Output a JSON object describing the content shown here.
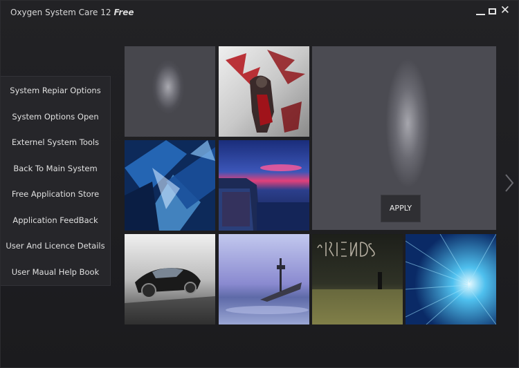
{
  "app": {
    "title": "Oxygen System Care 12",
    "edition": "Free"
  },
  "window_controls": {
    "minimize": "minimize-icon",
    "maximize": "maximize-icon",
    "close": "close-icon"
  },
  "sidebar": {
    "items": [
      {
        "label": "System Repiar Options"
      },
      {
        "label": "System Options Open"
      },
      {
        "label": "Externel System Tools"
      },
      {
        "label": "Back To Main System"
      },
      {
        "label": "Free Application Store"
      },
      {
        "label": "Application FeedBack"
      },
      {
        "label": "User And Licence Details"
      },
      {
        "label": "User Maual Help Book"
      }
    ]
  },
  "wallpapers": [
    {
      "name": "blurred-gray"
    },
    {
      "name": "red-warrior-art"
    },
    {
      "name": "blue-glass-abstract"
    },
    {
      "name": "coastal-sunset-city"
    },
    {
      "name": "black-sports-car"
    },
    {
      "name": "shipwreck-beach"
    },
    {
      "name": "my-friends-graffiti"
    },
    {
      "name": "binary-tunnel"
    }
  ],
  "preview": {
    "apply_label": "APPLY"
  },
  "nav": {
    "next": "chevron-right-icon"
  },
  "colors": {
    "background": "#1f1f22",
    "sidebar": "#26262a",
    "text": "#e0e0e0"
  }
}
